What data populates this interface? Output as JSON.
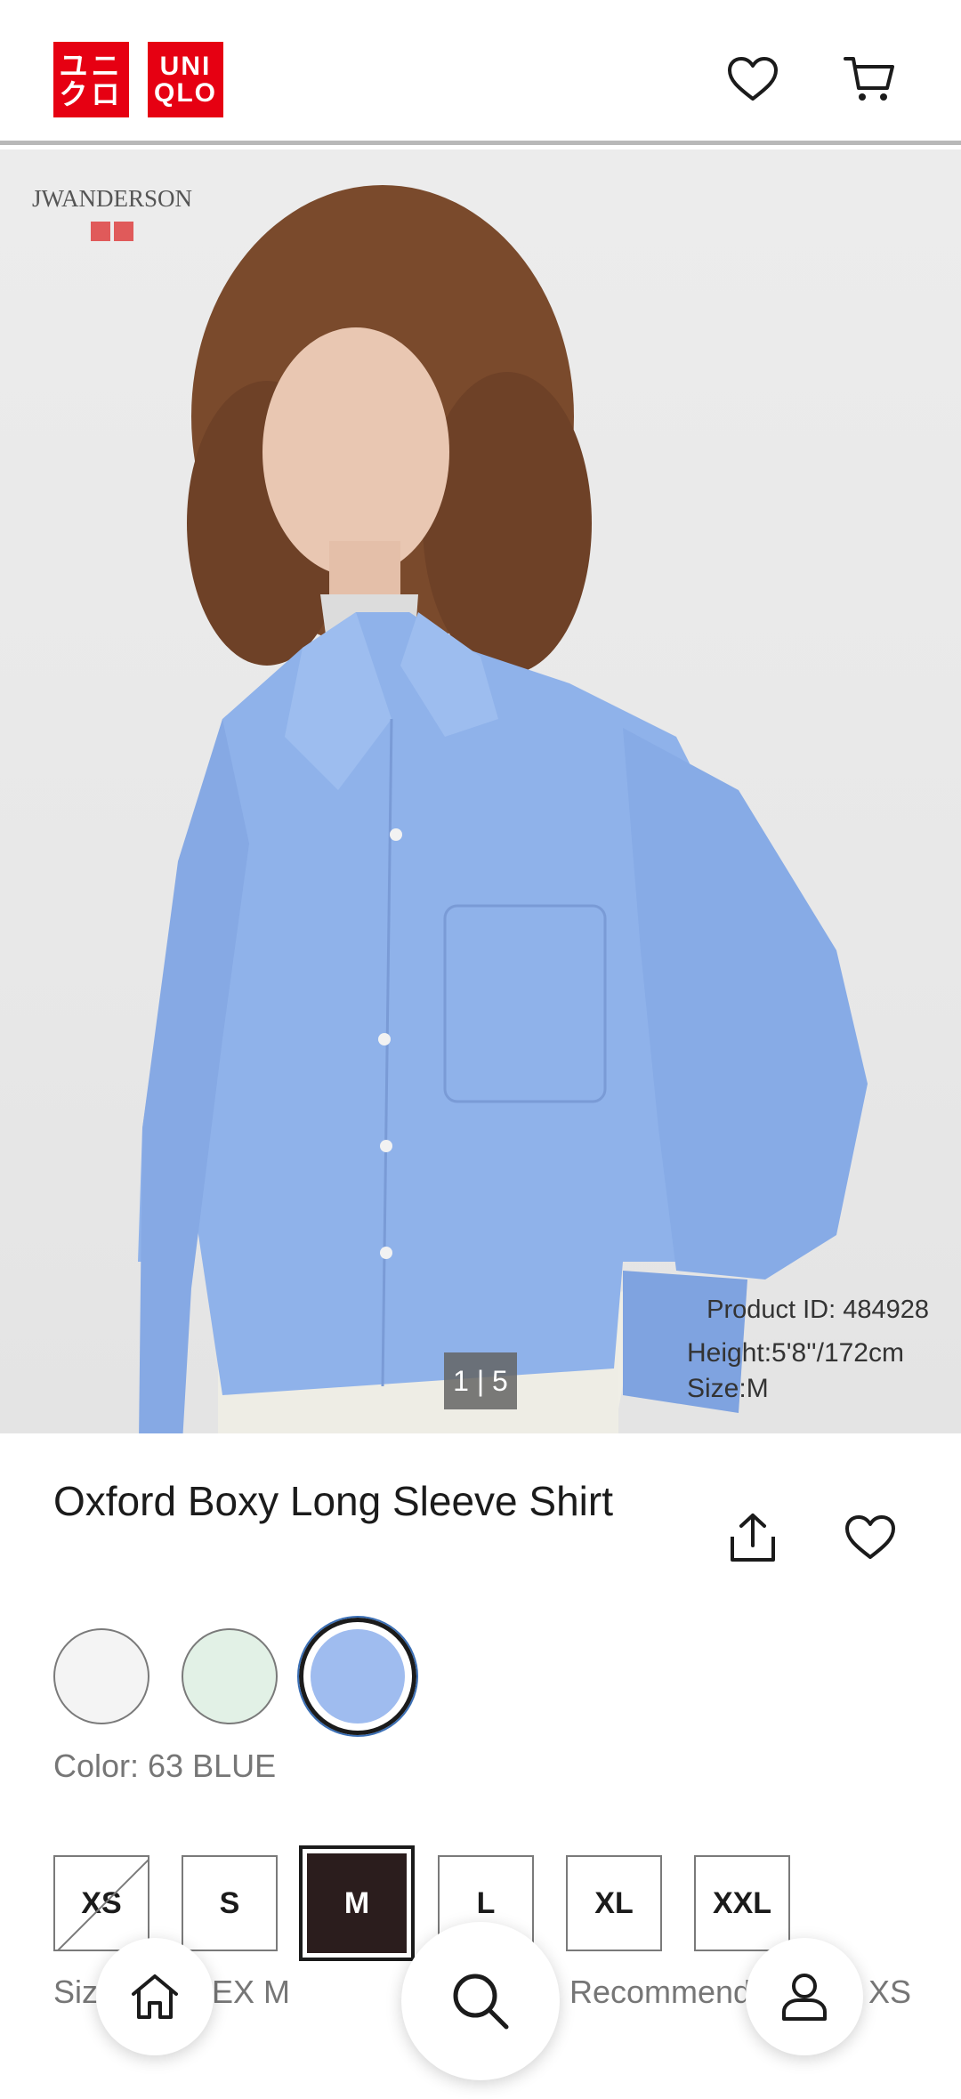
{
  "header": {
    "logo_top": "UNI",
    "logo_bottom": "QLO",
    "logo_kata_top": "ユニ",
    "logo_kata_bottom": "クロ",
    "icons": [
      "heart-icon",
      "cart-icon"
    ]
  },
  "hero": {
    "collab_brand": "JWANDERSON",
    "product_id_text": "Product ID: 484928",
    "height_text": "Height:5'8''/172cm",
    "size_text": "Size:M",
    "pager": "1 | 5"
  },
  "product": {
    "title": "Oxford Boxy Long Sleeve Shirt",
    "color_label": "Color: 63 BLUE",
    "swatches": [
      {
        "name": "off-white",
        "color": "#f4f4f4"
      },
      {
        "name": "light-green",
        "color": "#e2f1e6"
      },
      {
        "name": "blue",
        "color": "#9fbcef",
        "selected": true
      }
    ],
    "sizes": [
      "XS",
      "S",
      "M",
      "L",
      "XL",
      "XXL"
    ],
    "selected_size": "M",
    "unavailable_sizes": [
      "XS"
    ],
    "size_note_left": "Siz",
    "size_note_mid": "EX M",
    "size_note_right": "Recommend",
    "size_note_end": "XS"
  },
  "colors": {
    "brand_red": "#e60012",
    "text_dark": "#1b1b1b",
    "text_muted": "#767676"
  },
  "bottom_nav": [
    "home-icon",
    "search-icon",
    "account-icon"
  ]
}
